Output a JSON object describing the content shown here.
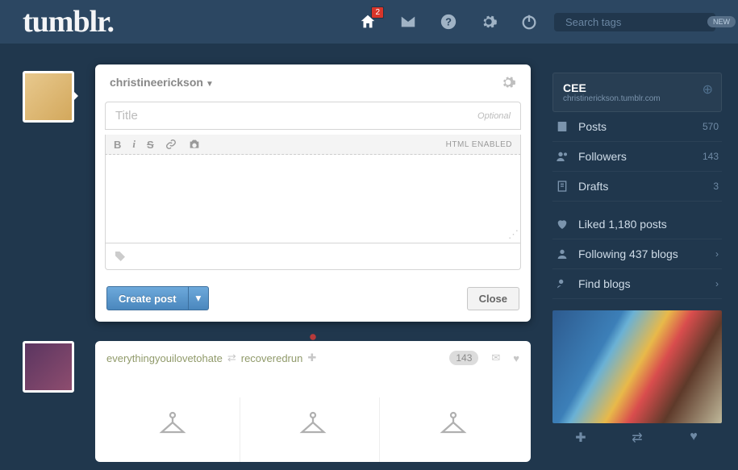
{
  "logo_text": "tumblr.",
  "nav": {
    "notif_count": "2"
  },
  "search": {
    "placeholder": "Search tags",
    "btn_label": "NEW"
  },
  "compose": {
    "username": "christineerickson",
    "title_placeholder": "Title",
    "optional_label": "Optional",
    "html_label": "HTML ENABLED",
    "create_label": "Create post",
    "close_label": "Close"
  },
  "feed": {
    "source1": "everythingyouilovetohate",
    "source2": "recoveredrun",
    "notes": "143"
  },
  "sidebar": {
    "title": "CEE",
    "subtitle": "christinerickson.tumblr.com",
    "rows": [
      {
        "label": "Posts",
        "count": "570"
      },
      {
        "label": "Followers",
        "count": "143"
      },
      {
        "label": "Drafts",
        "count": "3"
      }
    ],
    "liked_text": "Liked 1,180 posts",
    "following_text": "Following 437 blogs",
    "find_text": "Find blogs"
  }
}
